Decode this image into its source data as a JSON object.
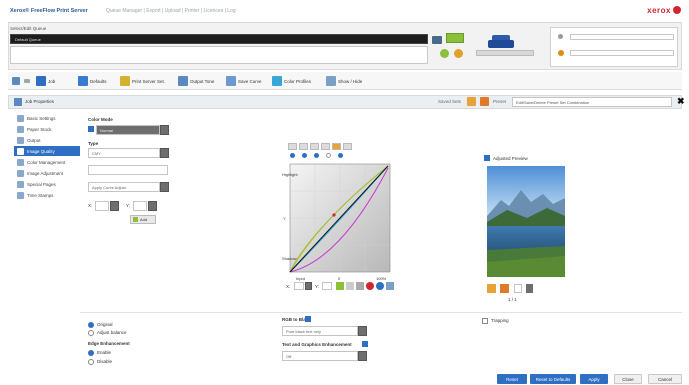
{
  "header": {
    "app_title": "Xerox® FreeFlow Print Server",
    "nav_links": "Queue Manager | Export | Upload | Printer | Licences | Log",
    "brand": "xerox"
  },
  "job": {
    "queue_label": "Select/Edit Queue",
    "queue_value": "Default Queue",
    "notes_value": ""
  },
  "toolbar": {
    "items": [
      "Job",
      "Defaults",
      "Print Server Set.",
      "Output Tone",
      "Save Curve",
      "Color Profiles",
      "Show / Hide"
    ]
  },
  "properties": {
    "title": "Job Properties",
    "saved_sets_label": "Saved Sets",
    "preset_label": "Preset",
    "preset_value": "Edit/Save/Delete Preset Set Combination"
  },
  "sidebar": {
    "items": [
      "Basic Settings",
      "Paper Stock",
      "Output",
      "Image Quality",
      "Color Management",
      "Image Adjustment",
      "Special Pages",
      "Time Stamps"
    ],
    "active_index": 3
  },
  "settings": {
    "color_mode_label": "Color Mode",
    "color_mode_value": "Normal",
    "type_label": "Type",
    "type_value": "CMY",
    "input_placeholder": "",
    "apply_curves_value": "Apply Curve Adjust",
    "x_label": "X:",
    "y_label": "Y:",
    "add_label": "Add"
  },
  "curves": {
    "y_labels": [
      "Highlight",
      "Y",
      "Shadow"
    ],
    "x_labels": [
      "Input",
      "0",
      "100%"
    ],
    "footer_x": "X:",
    "footer_y": "Y:"
  },
  "preview": {
    "checkbox_label": "Adjusted Preview",
    "caption": "1 / 1"
  },
  "lower": {
    "opt1": "Original",
    "opt2": "Adjust balance",
    "edge_title": "Edge Enhancement",
    "edge_enable": "Enable",
    "edge_disable": "Disable",
    "rgb_title": "RGB to Black",
    "rgb_value": "Pure black text only",
    "text_title": "Text and Graphics Enhancement",
    "text_value": "Off",
    "trapping_label": "Trapping"
  },
  "buttons": {
    "b1": "Reset",
    "b2": "Reset to Defaults",
    "b3": "Apply",
    "b4": "Close",
    "b5": "Cancel"
  },
  "colors": {
    "accent": "#2e6fc4",
    "brand": "#d0262d",
    "curve_cyan": "#2aa6d8",
    "curve_magenta": "#c43ad0",
    "curve_yellow": "#d8c02a",
    "curve_black": "#111111"
  }
}
